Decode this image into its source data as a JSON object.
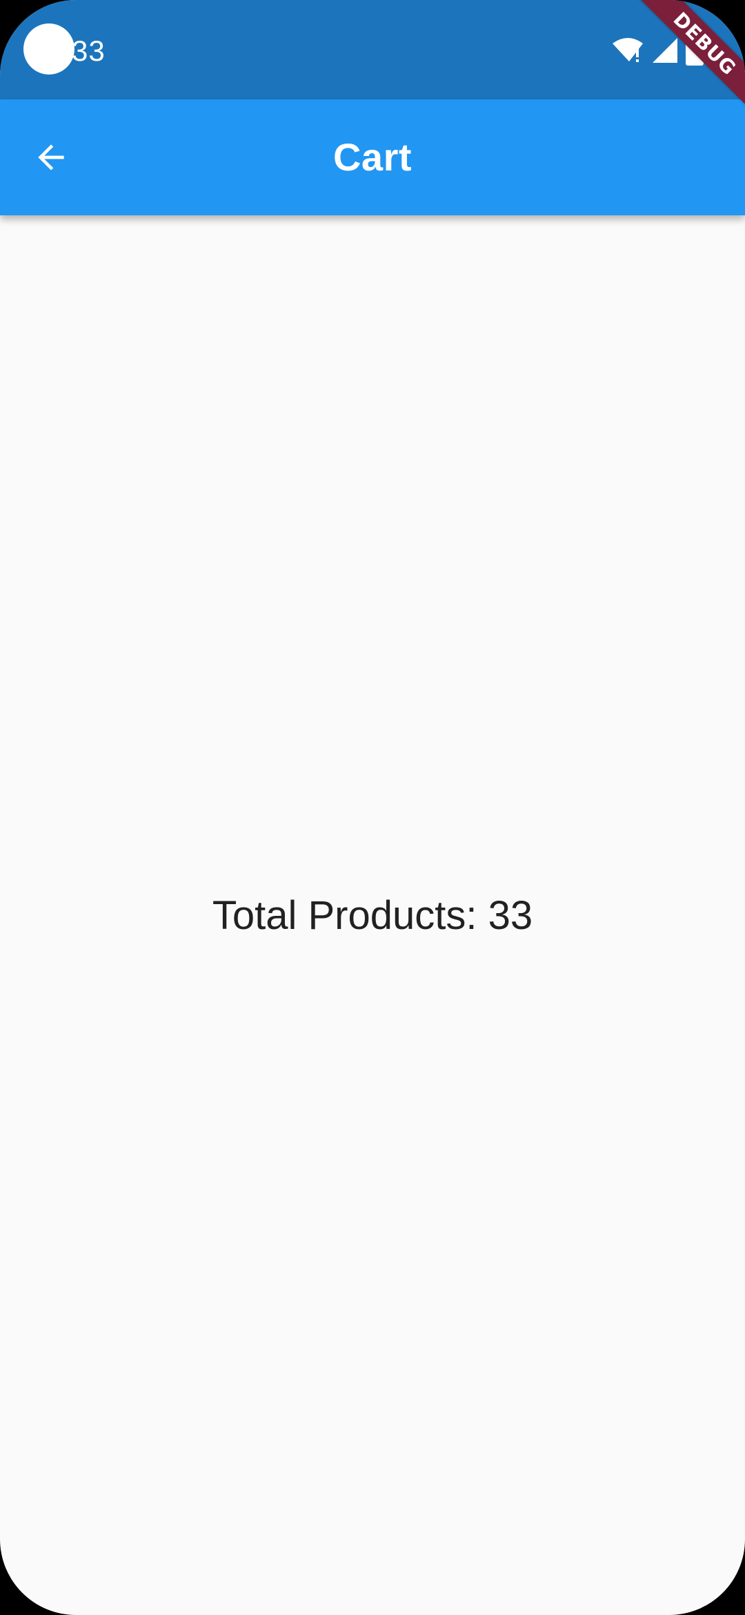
{
  "status_bar": {
    "time": "33",
    "icons": [
      "wifi-alert-icon",
      "signal-icon",
      "battery-icon"
    ]
  },
  "app_bar": {
    "back_icon": "arrow-back-icon",
    "title": "Cart"
  },
  "body": {
    "total_products_text": "Total Products: 33"
  },
  "debug_banner": {
    "label": "DEBUG"
  },
  "colors": {
    "status_bar": "#1c75bc",
    "app_bar": "#2196f3",
    "background": "#fafafa",
    "debug_banner": "#7b1f3a",
    "text_primary": "#212121"
  }
}
